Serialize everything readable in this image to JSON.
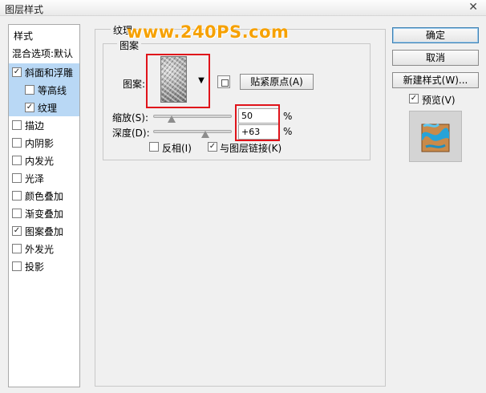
{
  "window": {
    "title": "图层样式"
  },
  "watermark": "www.240PS.com",
  "style_list": {
    "header": "样式",
    "blend_options": "混合选项:默认",
    "items": [
      {
        "label": "斜面和浮雕",
        "checked": true
      },
      {
        "label": "等高线",
        "checked": false
      },
      {
        "label": "纹理",
        "checked": true
      },
      {
        "label": "描边",
        "checked": false
      },
      {
        "label": "内阴影",
        "checked": false
      },
      {
        "label": "内发光",
        "checked": false
      },
      {
        "label": "光泽",
        "checked": false
      },
      {
        "label": "颜色叠加",
        "checked": false
      },
      {
        "label": "渐变叠加",
        "checked": false
      },
      {
        "label": "图案叠加",
        "checked": true
      },
      {
        "label": "外发光",
        "checked": false
      },
      {
        "label": "投影",
        "checked": false
      }
    ]
  },
  "texture_panel": {
    "group_title": "纹理",
    "subgroup_title": "图案",
    "pattern_label": "图案:",
    "snap_button": "贴紧原点(A)",
    "scale_label": "缩放(S):",
    "scale_value": "50",
    "scale_unit": "%",
    "scale_level": 0.5,
    "depth_label": "深度(D):",
    "depth_value": "+63",
    "depth_unit": "%",
    "depth_level": 0.63,
    "invert_label": "反相(I)",
    "invert_checked": false,
    "link_label": "与图层链接(K)",
    "link_checked": true
  },
  "actions": {
    "ok": "确定",
    "cancel": "取消",
    "new_style": "新建样式(W)...",
    "preview_label": "预览(V)",
    "preview_checked": true
  },
  "colors": {
    "highlight": "#b9d8f5",
    "annotation": "#e0131a",
    "watermark": "#f6a100"
  }
}
